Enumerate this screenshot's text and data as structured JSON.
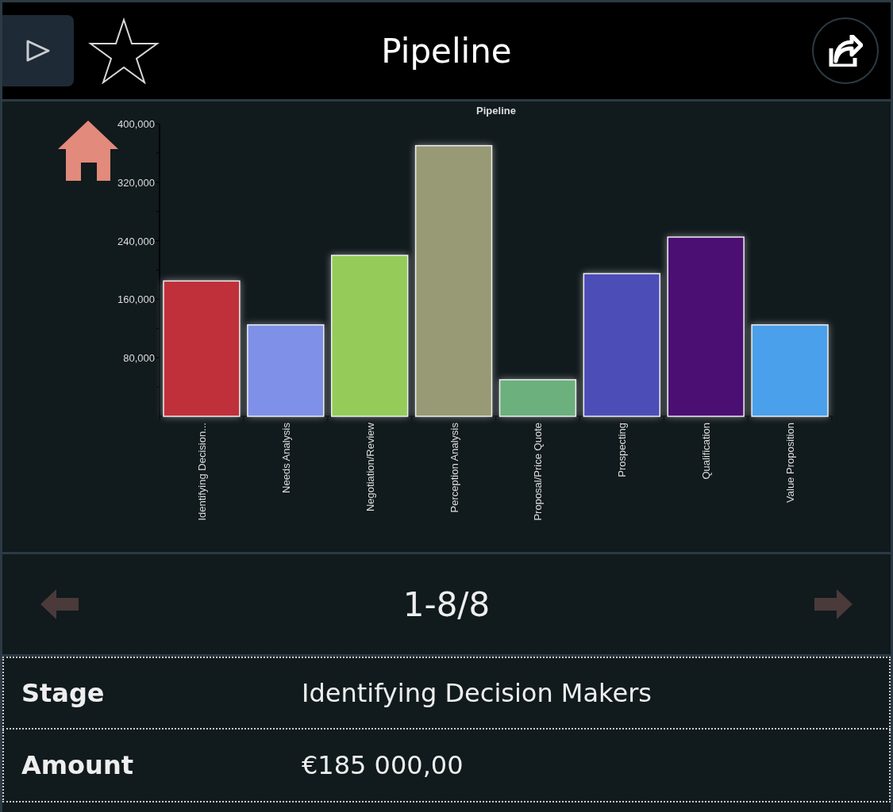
{
  "header": {
    "title": "Pipeline"
  },
  "chart": {
    "chart_data": {
      "type": "bar",
      "title": "Pipeline",
      "categories": [
        "Identifying Decision...",
        "Needs Analysis",
        "Negotiation/Review",
        "Perception Analysis",
        "Proposal/Price Quote",
        "Prospecting",
        "Qualification",
        "Value Proposition"
      ],
      "values": [
        185000,
        125000,
        220000,
        370000,
        50000,
        195000,
        245000,
        125000
      ],
      "ylim": [
        0,
        400000
      ],
      "yticks": [
        {
          "value": 80000,
          "label": "80,000"
        },
        {
          "value": 160000,
          "label": "160,000"
        },
        {
          "value": 240000,
          "label": "240,000"
        },
        {
          "value": 320000,
          "label": "320,000"
        },
        {
          "value": 400000,
          "label": "400,000"
        }
      ]
    }
  },
  "pager": {
    "label": "1-8/8"
  },
  "record": [
    {
      "label": "Stage",
      "value": "Identifying Decision Makers"
    },
    {
      "label": "Amount",
      "value": "€185 000,00"
    }
  ]
}
